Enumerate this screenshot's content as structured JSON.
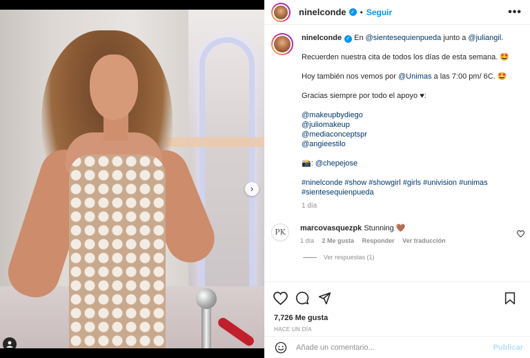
{
  "post": {
    "username": "ninelconde",
    "follow_label": "Seguir",
    "separator": "•",
    "more_label": "•••"
  },
  "caption": {
    "username": "ninelconde",
    "line1_prefix": "En ",
    "line1_mention1": "@sientesequienpueda",
    "line1_middle": " junto a ",
    "line1_mention2": "@juliangil",
    "line1_suffix": ".",
    "line2": "Recuerden nuestra cita de todos los días de esta semana. 🤩",
    "line3_prefix": "Hoy también nos vemos por ",
    "line3_mention": "@Unimas",
    "line3_suffix": " a las 7:00 pm/ 6C. 🤩",
    "line4": "Gracias siempre por todo el apoyo ♥:",
    "mentions": [
      "@makeupbydiego",
      "@juliomakeup",
      "@mediaconceptspr",
      "@angieestilo"
    ],
    "camera_prefix": "📸: ",
    "camera_mention": "@chepejose",
    "hashtags_line1": "#ninelconde #show #showgirl #girls #univision #unimas",
    "hashtags_line2": "#sientesequienpueda",
    "time": "1 día"
  },
  "comment": {
    "avatar_initials": "PK",
    "username": "marcovasquezpk",
    "text": " Stunning 🤎",
    "time": "1 día",
    "likes": "2 Me gusta",
    "reply_label": "Responder",
    "translate_label": "Ver traducción",
    "view_replies": "Ver respuestas (1)"
  },
  "actions": {
    "likes_count": "7,726 Me gusta",
    "posted_when": "HACE UN DÍA",
    "comment_placeholder": "Añade un comentario...",
    "publish_label": "Publicar"
  },
  "media": {
    "next_glyph": "›"
  },
  "colors": {
    "accent_blue": "#0095f6",
    "mention_blue": "#00376b",
    "muted_gray": "#8e8e8e",
    "publish_disabled": "#b2dffc"
  }
}
